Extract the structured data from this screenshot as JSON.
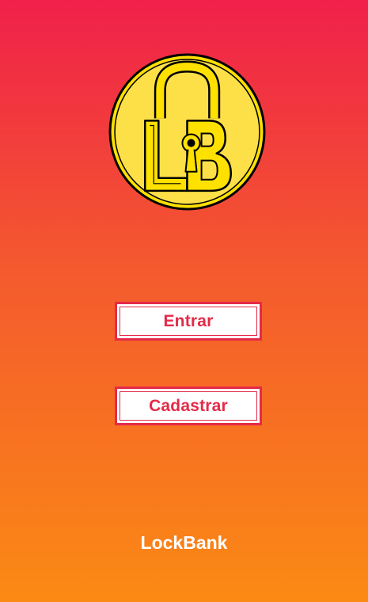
{
  "app": {
    "logo": {
      "icon": "padlock-lb-coin-logo",
      "text": "LB",
      "colors": {
        "coin": "#ffdd00",
        "outline": "#000000"
      }
    },
    "buttons": {
      "enter_label": "Entrar",
      "register_label": "Cadastrar"
    },
    "footer": {
      "brand_name": "LockBank"
    },
    "colors": {
      "background_top": "#f0204a",
      "background_bottom": "#fb8a14",
      "accent": "#e42a48",
      "button_bg": "#ffffff"
    }
  }
}
